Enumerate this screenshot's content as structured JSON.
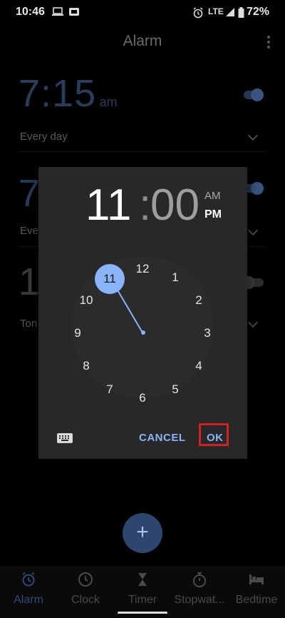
{
  "status": {
    "time": "10:46",
    "network": "LTE",
    "battery": "72%"
  },
  "app": {
    "title": "Alarm"
  },
  "alarms": [
    {
      "time": "7:15",
      "ampm": "am",
      "repeat": "Every day",
      "enabled": true
    },
    {
      "time": "7",
      "repeat": "Eve",
      "enabled": true
    },
    {
      "time": "1",
      "repeat": "Ton",
      "enabled": false
    }
  ],
  "dialog": {
    "hour": "11",
    "colon": ":",
    "minute": "00",
    "am": "AM",
    "pm": "PM",
    "selected_period": "PM",
    "selected_hour": "11",
    "clock_numbers": [
      "12",
      "1",
      "2",
      "3",
      "4",
      "5",
      "6",
      "7",
      "8",
      "9",
      "10",
      "11"
    ],
    "cancel_label": "CANCEL",
    "ok_label": "OK",
    "keyboard_icon": "keyboard-icon"
  },
  "fab": {
    "label": "+"
  },
  "nav": [
    {
      "label": "Alarm",
      "icon": "alarm-icon",
      "active": true
    },
    {
      "label": "Clock",
      "icon": "clock-icon",
      "active": false
    },
    {
      "label": "Timer",
      "icon": "hourglass-icon",
      "active": false
    },
    {
      "label": "Stopwat...",
      "icon": "stopwatch-icon",
      "active": false
    },
    {
      "label": "Bedtime",
      "icon": "bed-icon",
      "active": false
    }
  ],
  "colors": {
    "accent": "#8ab4f8",
    "dialog_bg": "#282828",
    "highlight": "#d32020"
  }
}
